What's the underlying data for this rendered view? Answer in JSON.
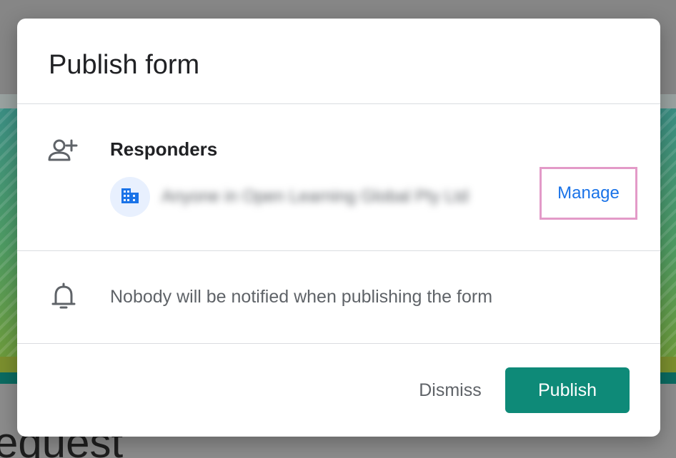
{
  "background": {
    "heading_fragment": "equest"
  },
  "dialog": {
    "title": "Publish form",
    "responders": {
      "icon": "person-add-icon",
      "title": "Responders",
      "org_icon": "domain-icon",
      "org_name": "Anyone in Open Learning Global Pty Ltd",
      "manage_label": "Manage"
    },
    "notification": {
      "icon": "bell-icon",
      "text": "Nobody will be notified when publishing the form"
    },
    "actions": {
      "dismiss_label": "Dismiss",
      "publish_label": "Publish"
    }
  },
  "colors": {
    "primary": "#0e8a78",
    "link": "#1a73e8",
    "highlight_border": "#e39ac8",
    "text_secondary": "#5f6368"
  }
}
